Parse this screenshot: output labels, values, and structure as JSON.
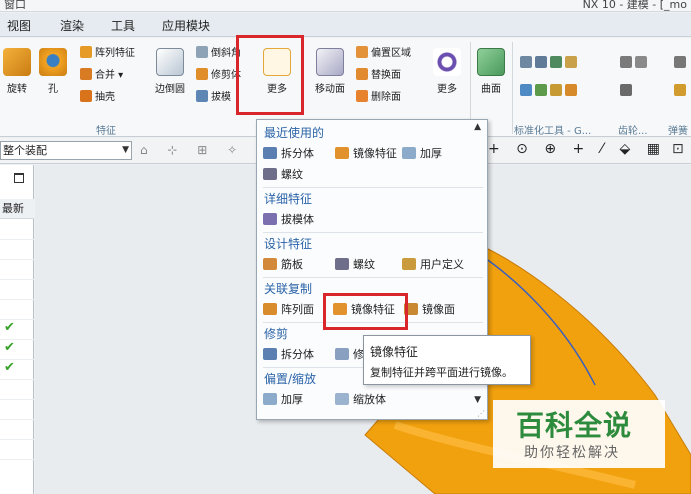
{
  "window": {
    "title_left": "窗口",
    "title_right": "NX 10 - 建模 - [_mo"
  },
  "menu": {
    "items": [
      "视图",
      "渲染",
      "工具",
      "应用模块"
    ]
  },
  "ribbon": {
    "rotate": "旋转",
    "hole": "孔",
    "pattern_feature": "阵列特征",
    "unite": "合并",
    "shell": "抽壳",
    "edge_blend": "边倒圆",
    "chamfer": "倒斜角",
    "trim_body": "修剪体",
    "draft": "拔模",
    "more": "更多",
    "move_face": "移动面",
    "offset_region": "偏置区域",
    "replace_face": "替换面",
    "delete_face": "删除面",
    "more2": "更多",
    "surface": "曲面",
    "group_feature": "特征",
    "group_standard": "标准化工具 - G...",
    "group_gear": "齿轮...",
    "group_spring": "弹簧"
  },
  "selection": {
    "assembly_filter": "整个装配"
  },
  "nav": {
    "header": "最新"
  },
  "dropdown": {
    "sec_recent": "最近使用的",
    "recent_split": "拆分体",
    "recent_mirror": "镜像特征",
    "recent_thicken": "加厚",
    "recent_thread": "螺纹",
    "sec_detail": "详细特征",
    "detail_draft_body": "拔模体",
    "sec_design": "设计特征",
    "design_rib": "筋板",
    "design_thread": "螺纹",
    "design_user": "用户定义",
    "sec_assoc": "关联复制",
    "assoc_pattern_face": "阵列面",
    "assoc_mirror_feature": "镜像特征",
    "assoc_mirror_face": "镜像面",
    "sec_trim": "修剪",
    "trim_split": "拆分体",
    "trim_second": "修",
    "sec_offset": "偏置/缩放",
    "offset_thicken": "加厚",
    "offset_scale": "缩放体"
  },
  "tooltip": {
    "title": "镜像特征",
    "desc": "复制特征并跨平面进行镜像。"
  },
  "watermark": {
    "title": "百科全说",
    "subtitle": "助你轻松解决"
  },
  "colors": {
    "highlight": "#d9262a",
    "section": "#2a63a8",
    "part": "#f2a10e",
    "check": "#38a12a"
  }
}
